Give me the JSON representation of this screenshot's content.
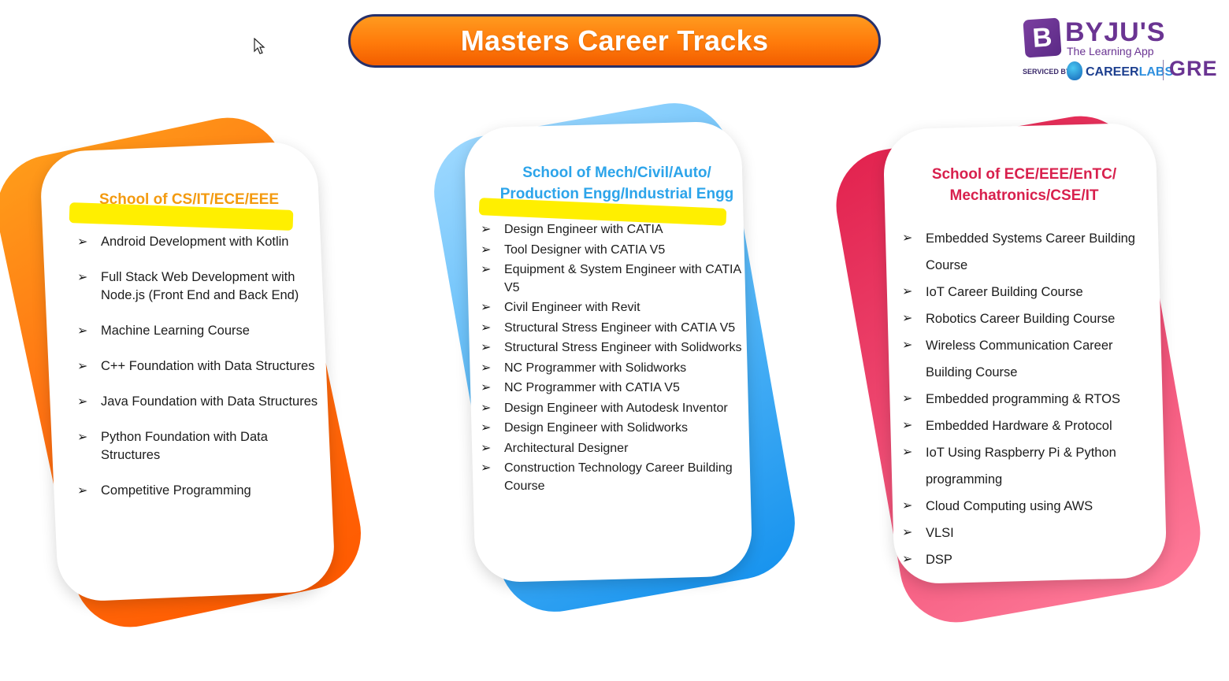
{
  "slide": {
    "title": "Masters Career Tracks"
  },
  "logo": {
    "brand": "BYJU'S",
    "tagline": "The Learning App",
    "serviced_by": "SERVICED BY",
    "partner_a": "CAREER",
    "partner_b": "LABS",
    "exam": "GRE",
    "icon": "byjus-b-logo-icon"
  },
  "colors": {
    "title_bg": "#ff7a0a",
    "orange_card": "#ff6a0a",
    "blue_card": "#3aa8f3",
    "pink_card": "#e8365f",
    "highlight": "#ffef00"
  },
  "cards": {
    "orange": {
      "heading": "School of CS/IT/ECE/EEE",
      "items": [
        "Android Development with Kotlin",
        "Full Stack Web Development with Node.js   (Front End and Back End)",
        "Machine Learning Course",
        "C++ Foundation with Data Structures",
        "Java Foundation with Data Structures",
        "Python Foundation with Data Structures",
        "Competitive Programming"
      ]
    },
    "blue": {
      "heading": "School of Mech/Civil/Auto/ Production Engg/Industrial Engg",
      "items": [
        "Design Engineer with CATIA",
        "Tool Designer with CATIA V5",
        "Equipment & System Engineer with CATIA V5",
        "Civil Engineer with Revit",
        "Structural Stress Engineer with CATIA V5",
        "Structural Stress Engineer with Solidworks",
        "NC Programmer with Solidworks",
        "NC Programmer with CATIA V5",
        "Design Engineer with Autodesk Inventor",
        "Design Engineer with Solidworks",
        "Architectural Designer",
        "Construction Technology Career Building Course"
      ]
    },
    "pink": {
      "heading": "School of ECE/EEE/EnTC/ Mechatronics/CSE/IT",
      "items": [
        "Embedded Systems Career Building Course",
        "IoT Career Building Course",
        "Robotics Career Building Course",
        "Wireless Communication Career Building Course",
        "Embedded programming & RTOS",
        "Embedded Hardware & Protocol",
        "IoT Using Raspberry Pi & Python programming",
        "Cloud Computing using AWS",
        "VLSI",
        "DSP"
      ]
    }
  },
  "bullet_glyph": "➢"
}
